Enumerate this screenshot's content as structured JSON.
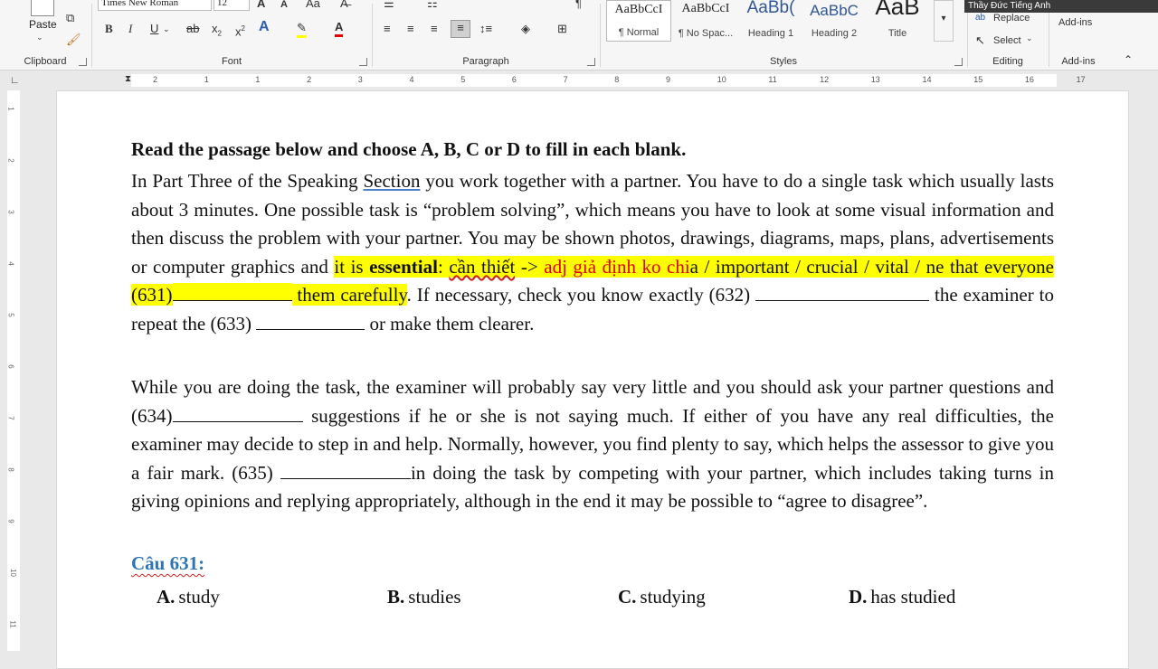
{
  "ribbon": {
    "clipboard": {
      "paste_label": "Paste",
      "group_label": "Clipboard"
    },
    "font": {
      "font_name": "Times New Roman",
      "font_size": "12",
      "case_label": "Aa",
      "group_label": "Font"
    },
    "paragraph": {
      "group_label": "Paragraph"
    },
    "styles": {
      "group_label": "Styles",
      "items": [
        {
          "sample": "AaBbCcI",
          "name": "¶ Normal"
        },
        {
          "sample": "AaBbCcI",
          "name": "¶ No Spac..."
        },
        {
          "sample": "AaBb(",
          "name": "Heading 1"
        },
        {
          "sample": "AaBbC",
          "name": "Heading 2"
        },
        {
          "sample": "AaB",
          "name": "Title"
        }
      ]
    },
    "editing": {
      "replace_label": "Replace",
      "select_label": "Select",
      "group_label": "Editing"
    },
    "addins": {
      "button_label": "Add-ins",
      "group_label": "Add-ins"
    }
  },
  "webcam": {
    "name": "Thầy Đức Tiếng Anh"
  },
  "ruler": {
    "numbers": [
      "2",
      "1",
      "1",
      "2",
      "3",
      "4",
      "5",
      "6",
      "7",
      "8",
      "9",
      "10",
      "11",
      "12",
      "13",
      "14",
      "15",
      "16",
      "17"
    ]
  },
  "vruler": {
    "numbers": [
      "1",
      "2",
      "3",
      "4",
      "5",
      "6",
      "7",
      "8",
      "9",
      "10",
      "11"
    ]
  },
  "document": {
    "heading": "Read the passage below and choose A, B, C or D to fill in each blank.",
    "p1": {
      "t1": "In Part Three of the Speaking ",
      "t1_underlined": "Section",
      "t2": " you work together with a partner. You have to do a single task which usually lasts about 3 minutes. One possible task is “problem solving”, which means you have to look at some visual information and then discuss the problem with your partner. You may be shown photos, drawings, diagrams, maps, plans, advertisements or computer graphics and ",
      "hl1": "it  is ",
      "hl_bold": "essential",
      "hl2": ": ",
      "hl_vn": "cần thiết",
      "hl3": " -> ",
      "hl_red": "adj giả định ko chi",
      "hl4": "a / important / crucial / vital / ne that everyone (631)",
      "hl5": " them carefully",
      "t3": ". If necessary, check you know exactly (632) ",
      "t4": " the examiner to repeat the (633) ",
      "t5": " or make them clearer."
    },
    "p2": {
      "t1": "While you are doing the task, the examiner will probably say very little and you should ask your partner questions and (634)",
      "t2": " suggestions if he or she is not saying much. If either of you have any real difficulties, the examiner may decide to step in and help. Normally, however, you find plenty to say, which helps the assessor to give you a fair mark. (635) ",
      "t3": "in doing the task by competing with your partner, which includes taking turns in giving opinions and replying appropriately, although in the end it may be possible to “agree to disagree”."
    },
    "question": {
      "title": "Câu 631:",
      "options": [
        {
          "letter": "A.",
          "text": "study"
        },
        {
          "letter": "B.",
          "text": "studies"
        },
        {
          "letter": "C.",
          "text": "studying"
        },
        {
          "letter": "D.",
          "text": "has studied"
        }
      ]
    }
  },
  "colors": {
    "highlight": "#ffff00",
    "question_blue": "#2e75b6",
    "red_text": "#e00000"
  }
}
